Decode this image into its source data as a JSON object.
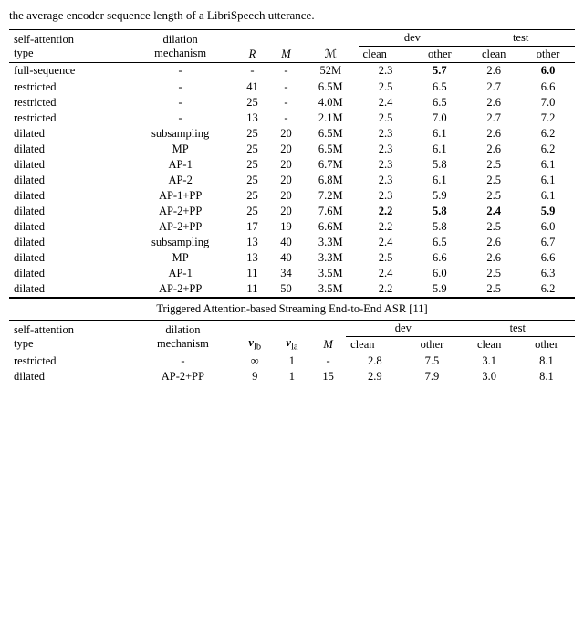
{
  "intro": "the average encoder sequence length of a LibriSpeech utterance.",
  "table1": {
    "col_headers": [
      "self-attention type",
      "dilation mechanism",
      "R",
      "M",
      "𝓜",
      "dev clean",
      "dev other",
      "test clean",
      "test other"
    ],
    "rows": [
      {
        "type": "full-sequence",
        "dilation": "-",
        "R": "-",
        "M": "-",
        "script_M": "52M",
        "dev_clean": "2.3",
        "dev_other": "5.7",
        "test_clean": "2.6",
        "test_other": "6.0",
        "bold_dev_clean": false,
        "bold_dev_other": true,
        "bold_test_clean": false,
        "bold_test_other": true
      },
      {
        "type": "restricted",
        "dilation": "-",
        "R": "41",
        "M": "-",
        "script_M": "6.5M",
        "dev_clean": "2.5",
        "dev_other": "6.5",
        "test_clean": "2.7",
        "test_other": "6.6",
        "bold_dev_clean": false,
        "bold_dev_other": false,
        "bold_test_clean": false,
        "bold_test_other": false
      },
      {
        "type": "restricted",
        "dilation": "-",
        "R": "25",
        "M": "-",
        "script_M": "4.0M",
        "dev_clean": "2.4",
        "dev_other": "6.5",
        "test_clean": "2.6",
        "test_other": "7.0",
        "bold_dev_clean": false,
        "bold_dev_other": false,
        "bold_test_clean": false,
        "bold_test_other": false
      },
      {
        "type": "restricted",
        "dilation": "-",
        "R": "13",
        "M": "-",
        "script_M": "2.1M",
        "dev_clean": "2.5",
        "dev_other": "7.0",
        "test_clean": "2.7",
        "test_other": "7.2",
        "bold_dev_clean": false,
        "bold_dev_other": false,
        "bold_test_clean": false,
        "bold_test_other": false
      },
      {
        "type": "dilated",
        "dilation": "subsampling",
        "R": "25",
        "M": "20",
        "script_M": "6.5M",
        "dev_clean": "2.3",
        "dev_other": "6.1",
        "test_clean": "2.6",
        "test_other": "6.2",
        "bold_dev_clean": false,
        "bold_dev_other": false,
        "bold_test_clean": false,
        "bold_test_other": false
      },
      {
        "type": "dilated",
        "dilation": "MP",
        "R": "25",
        "M": "20",
        "script_M": "6.5M",
        "dev_clean": "2.3",
        "dev_other": "6.1",
        "test_clean": "2.6",
        "test_other": "6.2",
        "bold_dev_clean": false,
        "bold_dev_other": false,
        "bold_test_clean": false,
        "bold_test_other": false
      },
      {
        "type": "dilated",
        "dilation": "AP-1",
        "R": "25",
        "M": "20",
        "script_M": "6.7M",
        "dev_clean": "2.3",
        "dev_other": "5.8",
        "test_clean": "2.5",
        "test_other": "6.1",
        "bold_dev_clean": false,
        "bold_dev_other": false,
        "bold_test_clean": false,
        "bold_test_other": false
      },
      {
        "type": "dilated",
        "dilation": "AP-2",
        "R": "25",
        "M": "20",
        "script_M": "6.8M",
        "dev_clean": "2.3",
        "dev_other": "6.1",
        "test_clean": "2.5",
        "test_other": "6.1",
        "bold_dev_clean": false,
        "bold_dev_other": false,
        "bold_test_clean": false,
        "bold_test_other": false
      },
      {
        "type": "dilated",
        "dilation": "AP-1+PP",
        "R": "25",
        "M": "20",
        "script_M": "7.2M",
        "dev_clean": "2.3",
        "dev_other": "5.9",
        "test_clean": "2.5",
        "test_other": "6.1",
        "bold_dev_clean": false,
        "bold_dev_other": false,
        "bold_test_clean": false,
        "bold_test_other": false
      },
      {
        "type": "dilated",
        "dilation": "AP-2+PP",
        "R": "25",
        "M": "20",
        "script_M": "7.6M",
        "dev_clean": "2.2",
        "dev_other": "5.8",
        "test_clean": "2.4",
        "test_other": "5.9",
        "bold_dev_clean": true,
        "bold_dev_other": true,
        "bold_test_clean": true,
        "bold_test_other": true
      },
      {
        "type": "dilated",
        "dilation": "AP-2+PP",
        "R": "17",
        "M": "19",
        "script_M": "6.6M",
        "dev_clean": "2.2",
        "dev_other": "5.8",
        "test_clean": "2.5",
        "test_other": "6.0",
        "bold_dev_clean": false,
        "bold_dev_other": false,
        "bold_test_clean": false,
        "bold_test_other": false
      },
      {
        "type": "dilated",
        "dilation": "subsampling",
        "R": "13",
        "M": "40",
        "script_M": "3.3M",
        "dev_clean": "2.4",
        "dev_other": "6.5",
        "test_clean": "2.6",
        "test_other": "6.7",
        "bold_dev_clean": false,
        "bold_dev_other": false,
        "bold_test_clean": false,
        "bold_test_other": false
      },
      {
        "type": "dilated",
        "dilation": "MP",
        "R": "13",
        "M": "40",
        "script_M": "3.3M",
        "dev_clean": "2.5",
        "dev_other": "6.6",
        "test_clean": "2.6",
        "test_other": "6.6",
        "bold_dev_clean": false,
        "bold_dev_other": false,
        "bold_test_clean": false,
        "bold_test_other": false
      },
      {
        "type": "dilated",
        "dilation": "AP-1",
        "R": "11",
        "M": "34",
        "script_M": "3.5M",
        "dev_clean": "2.4",
        "dev_other": "6.0",
        "test_clean": "2.5",
        "test_other": "6.3",
        "bold_dev_clean": false,
        "bold_dev_other": false,
        "bold_test_clean": false,
        "bold_test_other": false
      },
      {
        "type": "dilated",
        "dilation": "AP-2+PP",
        "R": "11",
        "M": "50",
        "script_M": "3.5M",
        "dev_clean": "2.2",
        "dev_other": "5.9",
        "test_clean": "2.5",
        "test_other": "6.2",
        "bold_dev_clean": false,
        "bold_dev_other": false,
        "bold_test_clean": false,
        "bold_test_other": false
      }
    ]
  },
  "caption": "Triggered Attention-based Streaming End-to-End ASR [11]",
  "table2": {
    "col_headers": [
      "self-attention type",
      "dilation mechanism",
      "v_lb",
      "v_la",
      "M",
      "dev clean",
      "dev other",
      "test clean",
      "test other"
    ],
    "rows": [
      {
        "type": "restricted",
        "dilation": "-",
        "vlb": "∞",
        "vla": "1",
        "M": "-",
        "dev_clean": "2.8",
        "dev_other": "7.5",
        "test_clean": "3.1",
        "test_other": "8.1"
      },
      {
        "type": "dilated",
        "dilation": "AP-2+PP",
        "vlb": "9",
        "vla": "1",
        "M": "15",
        "dev_clean": "2.9",
        "dev_other": "7.9",
        "test_clean": "3.0",
        "test_other": "8.1"
      }
    ]
  }
}
